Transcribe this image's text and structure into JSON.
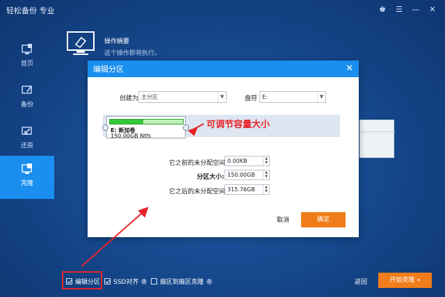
{
  "app": {
    "title": "轻松备份 专业"
  },
  "window_controls": [
    "crown-icon",
    "menu-icon",
    "minimize-icon",
    "close-icon"
  ],
  "sidebar": {
    "items": [
      {
        "label": "首页",
        "icon": "home-icon"
      },
      {
        "label": "备份",
        "icon": "backup-icon"
      },
      {
        "label": "还原",
        "icon": "restore-icon"
      },
      {
        "label": "克隆",
        "icon": "clone-icon",
        "active": true
      }
    ]
  },
  "header": {
    "title": "操作摘要",
    "subtitle": "这个操作即将执行。"
  },
  "dialog": {
    "title": "编辑分区",
    "create_as_label": "创建为",
    "create_as_value": "主分区",
    "drive_letter_label": "盘符",
    "drive_letter_value": "E:",
    "partition_name": "E: 新加卷",
    "partition_size": "150.00GB Ntfs",
    "used_fraction": 0.47,
    "unalloc_before_label": "它之前的未分配空间:",
    "unalloc_before_value": "0.00KB",
    "partition_size_label": "分区大小:",
    "partition_size_value": "150.00GB",
    "unalloc_after_label": "它之后的未分配空间:",
    "unalloc_after_value": "315.76GB",
    "cancel_label": "取消",
    "ok_label": "确定"
  },
  "annotation": {
    "text": "可调节容量大小",
    "color": "#e8242a"
  },
  "bottom": {
    "edit_partition_label": "编辑分区",
    "ssd_align_label": "SSD对齐",
    "sector_clone_label": "扇区到扇区克隆",
    "back_label": "返回",
    "start_label": "开始克隆 »"
  },
  "colors": {
    "accent": "#1a8ff0",
    "action": "#f07d1a",
    "partition": "#34c93a"
  }
}
